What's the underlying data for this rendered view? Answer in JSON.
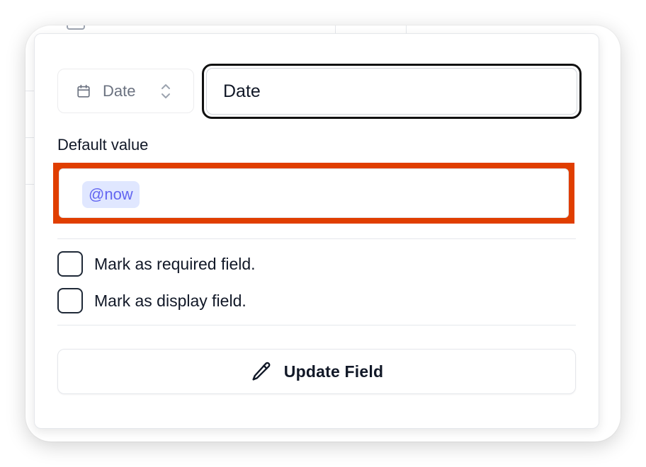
{
  "field_editor": {
    "type_select": {
      "value": "Date",
      "icon": "calendar-icon"
    },
    "name_input": {
      "value": "Date"
    },
    "default_value": {
      "label": "Default value",
      "chip": "@now"
    },
    "checkboxes": [
      {
        "label": "Mark as required field.",
        "checked": false
      },
      {
        "label": "Mark as display field.",
        "checked": false
      }
    ],
    "update_button": {
      "label": "Update Field",
      "icon": "pencil-icon"
    }
  },
  "colors": {
    "highlight": "#e03e00",
    "chip_bg": "#e0e7ff",
    "chip_text": "#6366f1",
    "focus_ring": "#111111"
  }
}
